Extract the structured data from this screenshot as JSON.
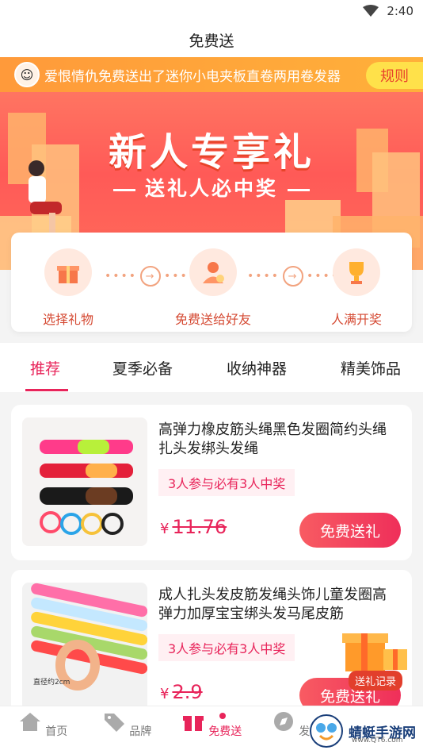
{
  "status_bar": {
    "time": "2:40"
  },
  "title": "免费送",
  "ticker": {
    "message": "爱恨情仇免费送出了迷你小电夹板直卷两用卷发器",
    "rules_label": "规则"
  },
  "hero": {
    "title": "新人专享礼",
    "subtitle": "送礼人必中奖"
  },
  "steps": [
    {
      "label": "选择礼物",
      "icon": "gift-icon"
    },
    {
      "label": "免费送给好友",
      "icon": "friend-icon"
    },
    {
      "label": "人满开奖",
      "icon": "trophy-icon"
    }
  ],
  "tabs": [
    {
      "label": "推荐",
      "active": true
    },
    {
      "label": "夏季必备"
    },
    {
      "label": "收纳神器"
    },
    {
      "label": "精美饰品"
    }
  ],
  "products": [
    {
      "title": "高弹力橡皮筋头绳黑色发圈简约头绳扎头发绑头发绳",
      "badge": "3人参与必有3人中奖",
      "currency": "¥",
      "price": "11.76",
      "button": "免费送礼"
    },
    {
      "title": "成人扎头发皮筋发绳头饰儿童发圈高弹力加厚宝宝绑头发马尾皮筋",
      "badge": "3人参与必有3人中奖",
      "currency": "¥",
      "price": "2.9",
      "button": "免费送礼",
      "thumb_caption": "直径约2cm"
    }
  ],
  "float_record": {
    "label": "送礼记录"
  },
  "bottom_nav": [
    {
      "label": "首页",
      "icon": "home-icon"
    },
    {
      "label": "品牌",
      "icon": "tag-icon"
    },
    {
      "label": "免费送",
      "icon": "gift-icon",
      "active": true
    },
    {
      "label": "发现",
      "icon": "compass-icon"
    }
  ],
  "watermark": {
    "text": "蜻蜓手游网",
    "url": "www.QT6.com"
  },
  "colors": {
    "accent": "#e8245a",
    "hero": "#ff5a57",
    "ticker": "#ffa43a"
  }
}
